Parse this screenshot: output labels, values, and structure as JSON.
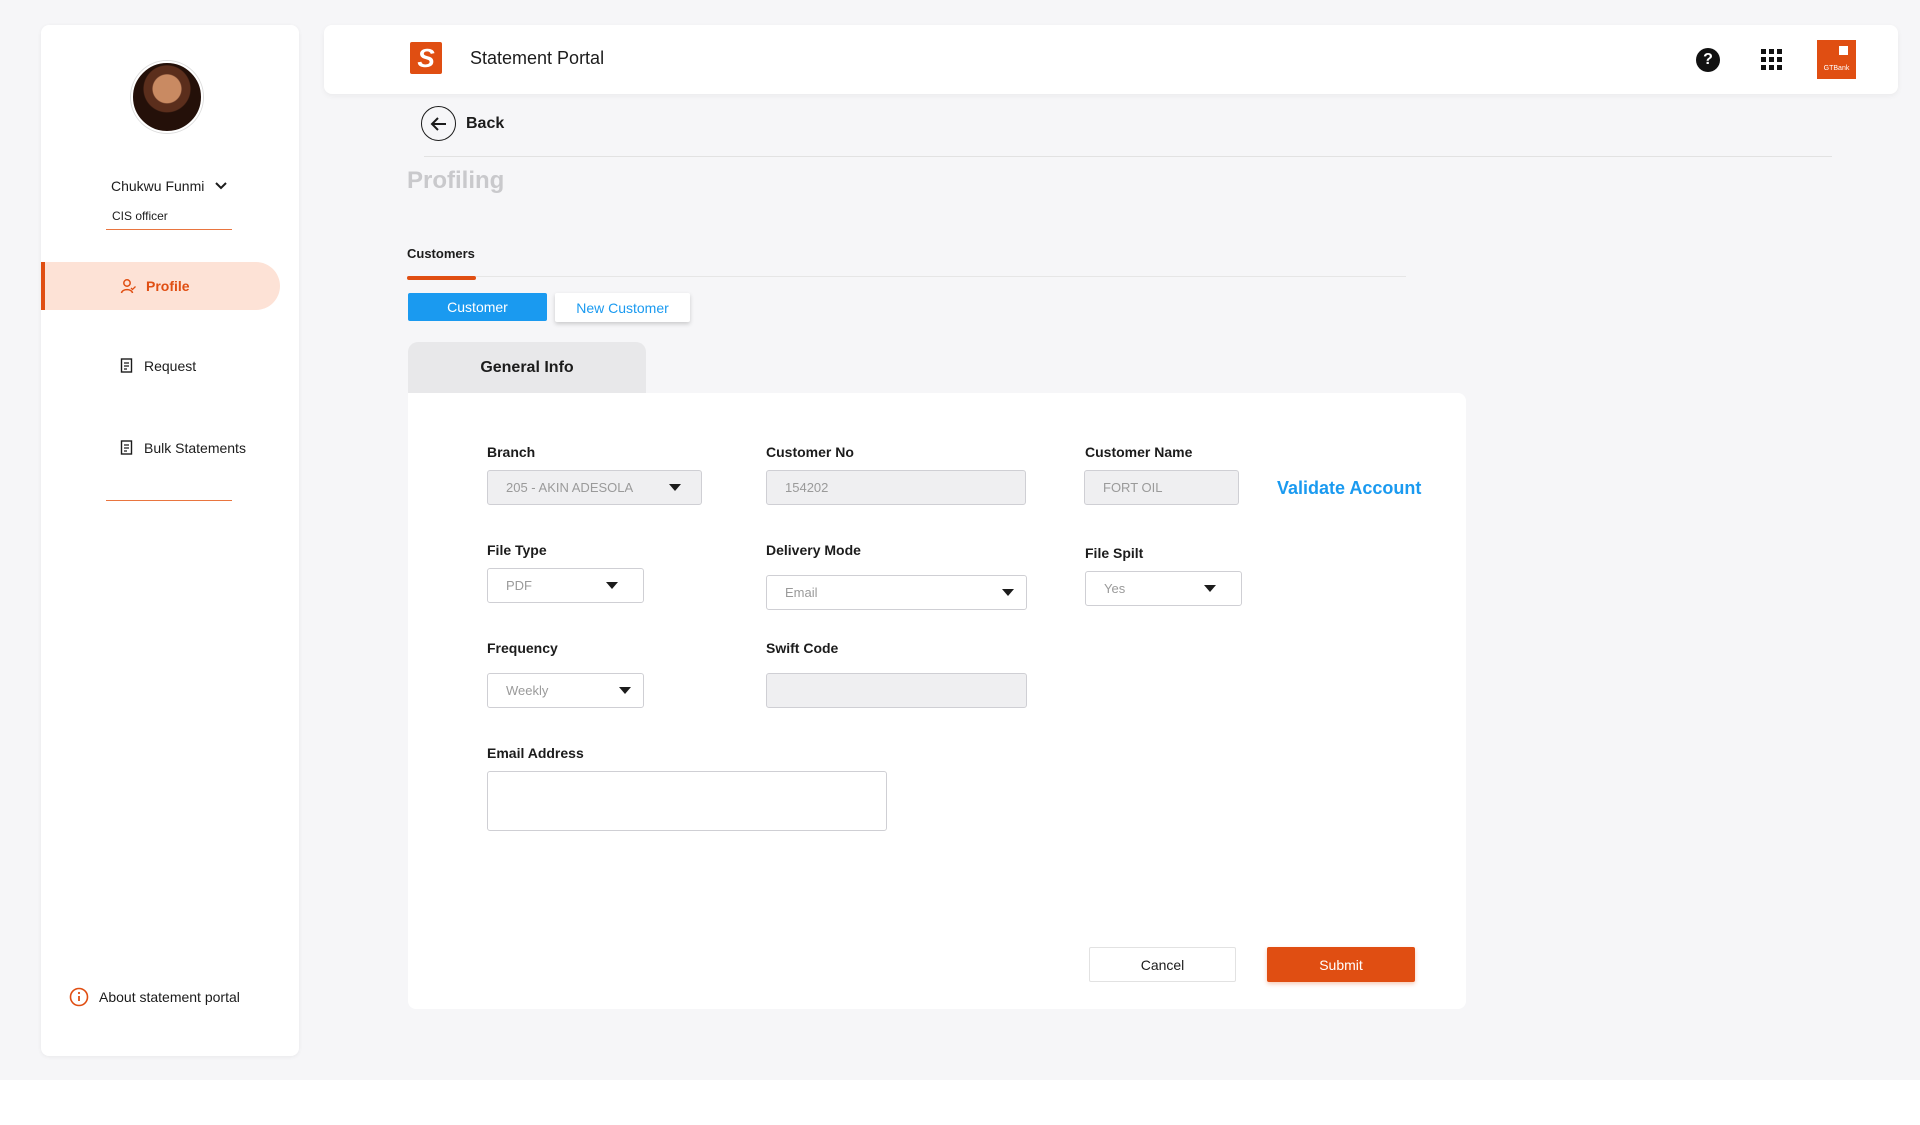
{
  "colors": {
    "accent": "#e04e12",
    "primary_blue": "#1a9af0",
    "active_nav_bg": "#fde2d6"
  },
  "sidebar": {
    "user": {
      "name": "Chukwu Funmi",
      "role": "CIS officer"
    },
    "items": [
      {
        "label": "Profile",
        "icon": "user-icon",
        "active": true
      },
      {
        "label": "Request",
        "icon": "document-icon",
        "active": false
      },
      {
        "label": "Bulk Statements",
        "icon": "document-icon",
        "active": false
      }
    ],
    "about_label": "About statement portal"
  },
  "header": {
    "logo_letter": "S",
    "title": "Statement Portal",
    "bank_label": "GTBank",
    "help_glyph": "?"
  },
  "nav": {
    "back_label": "Back"
  },
  "page": {
    "title": "Profiling"
  },
  "tabs": {
    "customers_label": "Customers"
  },
  "toggle": {
    "customer_label": "Customer",
    "new_customer_label": "New Customer"
  },
  "form": {
    "section_label": "General Info",
    "branch": {
      "label": "Branch",
      "value": "205 - AKIN ADESOLA"
    },
    "customer_no": {
      "label": "Customer No",
      "value": "154202"
    },
    "customer_name": {
      "label": "Customer Name",
      "value": "FORT OIL"
    },
    "validate_label": "Validate Account",
    "file_type": {
      "label": "File Type",
      "value": "PDF"
    },
    "delivery_mode": {
      "label": "Delivery Mode",
      "value": "Email"
    },
    "file_split": {
      "label": "File Spilt",
      "value": "Yes"
    },
    "frequency": {
      "label": "Frequency",
      "value": "Weekly"
    },
    "swift_code": {
      "label": "Swift Code",
      "value": ""
    },
    "email": {
      "label": "Email Address",
      "value": ""
    },
    "cancel_label": "Cancel",
    "submit_label": "Submit"
  }
}
